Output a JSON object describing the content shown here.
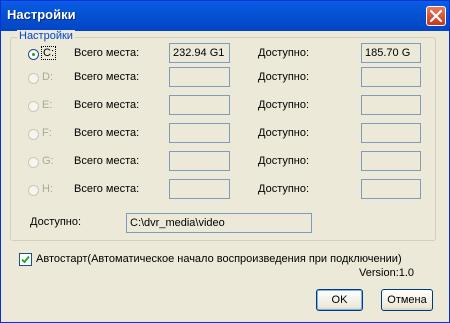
{
  "window": {
    "title": "Настройки"
  },
  "group": {
    "label": "Настройки"
  },
  "labels": {
    "total": "Всего места:",
    "free": "Доступно:"
  },
  "drives": [
    {
      "letter": "C:",
      "total": "232.94 G1",
      "free": "185.70 G",
      "selected": true,
      "enabled": true
    },
    {
      "letter": "D:",
      "total": "",
      "free": "",
      "selected": false,
      "enabled": false
    },
    {
      "letter": "E:",
      "total": "",
      "free": "",
      "selected": false,
      "enabled": false
    },
    {
      "letter": "F:",
      "total": "",
      "free": "",
      "selected": false,
      "enabled": false
    },
    {
      "letter": "G:",
      "total": "",
      "free": "",
      "selected": false,
      "enabled": false
    },
    {
      "letter": "H:",
      "total": "",
      "free": "",
      "selected": false,
      "enabled": false
    }
  ],
  "path": {
    "label": "Доступно:",
    "value": "C:\\dvr_media\\video"
  },
  "autostart": {
    "label": "Автостарт(Автоматическое начало воспроизведения при подключении)",
    "checked": true
  },
  "version": "Version:1.0",
  "buttons": {
    "ok": "OK",
    "cancel": "Отмена"
  },
  "colors": {
    "titlebar": "#0451d2",
    "dialog_bg": "#ece9d8",
    "group_label": "#0046d5",
    "radio_dot": "#21a121"
  }
}
